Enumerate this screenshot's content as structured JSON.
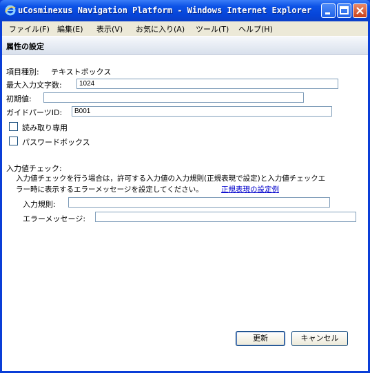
{
  "window": {
    "title": "uCosminexus Navigation Platform - Windows Internet Explorer"
  },
  "menu": {
    "items": [
      "ファイル(F)",
      "編集(E)",
      "表示(V)",
      "お気に入り(A)",
      "ツール(T)",
      "ヘルプ(H)"
    ]
  },
  "form": {
    "heading": "属性の設定",
    "item_type_label": "項目種別:",
    "item_type_value": "テキストボックス",
    "max_length_label": "最大入力文字数:",
    "max_length_value": "1024",
    "initial_value_label": "初期値:",
    "initial_value_value": "",
    "guide_parts_id_label": "ガイドパーツID:",
    "guide_parts_id_value": "B001",
    "readonly_label": "読み取り専用",
    "readonly_checked": false,
    "password_label": "パスワードボックス",
    "password_checked": false,
    "input_check_title": "入力値チェック:",
    "input_check_desc_line1": "入力値チェックを行う場合は，許可する入力値の入力規則(正規表現で設定)と入力値チェックエ",
    "input_check_desc_line2": "ラー時に表示するエラーメッセージを設定してください。",
    "regex_example_link": "正規表現の設定例",
    "input_rule_label": "入力規則:",
    "input_rule_value": "",
    "error_message_label": "エラーメッセージ:",
    "error_message_value": ""
  },
  "buttons": {
    "update": "更新",
    "cancel": "キャンセル"
  },
  "colors": {
    "titlebar": "#0c52e6",
    "link": "#0000cc",
    "input_border": "#7f9db9"
  }
}
